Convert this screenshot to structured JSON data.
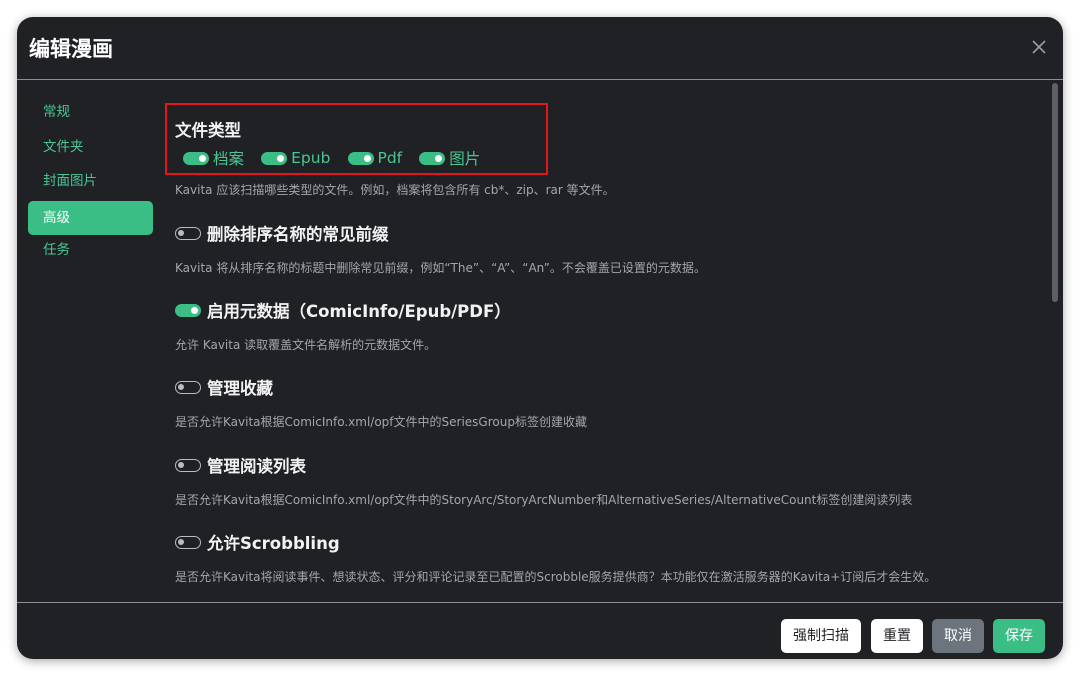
{
  "dialog": {
    "title": "编辑漫画"
  },
  "sidebar": {
    "items": [
      {
        "label": "常规",
        "active": false
      },
      {
        "label": "文件夹",
        "active": false
      },
      {
        "label": "封面图片",
        "active": false
      },
      {
        "label": "高级",
        "active": true
      },
      {
        "label": "任务",
        "active": false
      }
    ]
  },
  "file_types": {
    "title": "文件类型",
    "options": [
      {
        "label": "档案",
        "on": true
      },
      {
        "label": "Epub",
        "on": true
      },
      {
        "label": "Pdf",
        "on": true
      },
      {
        "label": "图片",
        "on": true
      }
    ],
    "description": "Kavita 应该扫描哪些类型的文件。例如，档案将包含所有 cb*、zip、rar 等文件。"
  },
  "settings": [
    {
      "label": "删除排序名称的常见前缀",
      "on": false,
      "description": "Kavita 将从排序名称的标题中删除常见前缀，例如“The”、“A”、“An”。不会覆盖已设置的元数据。"
    },
    {
      "label": "启用元数据（ComicInfo/Epub/PDF）",
      "on": true,
      "description": "允许 Kavita 读取覆盖文件名解析的元数据文件。"
    },
    {
      "label": "管理收藏",
      "on": false,
      "description": "是否允许Kavita根据ComicInfo.xml/opf文件中的SeriesGroup标签创建收藏"
    },
    {
      "label": "管理阅读列表",
      "on": false,
      "description": "是否允许Kavita根据ComicInfo.xml/opf文件中的StoryArc/StoryArcNumber和AlternativeSeries/AlternativeCount标签创建阅读列表"
    },
    {
      "label": "允许Scrobbling",
      "on": false,
      "description": "是否允许Kavita将阅读事件、想读状态、评分和评论记录至已配置的Scrobble服务提供商？本功能仅在激活服务器的Kavita+订阅后才会生效。"
    }
  ],
  "footer": {
    "force_scan": "强制扫描",
    "reset": "重置",
    "cancel": "取消",
    "save": "保存"
  },
  "colors": {
    "accent": "#3bbd86",
    "background": "#1f2124",
    "highlight_box": "#e31717"
  }
}
